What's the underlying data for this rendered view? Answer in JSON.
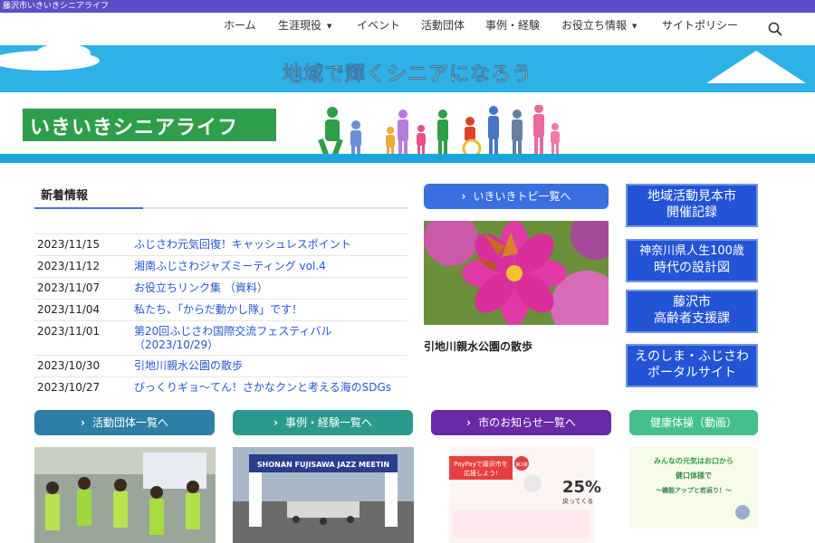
{
  "site": {
    "title": "藤沢市いきいきシニアライフ"
  },
  "nav": {
    "items": [
      "ホーム",
      "生涯現役",
      "イベント",
      "活動団体",
      "事例・経験",
      "お役立ち情報",
      "サイトポリシー"
    ]
  },
  "banner": {
    "slogan": "地域で輝くシニアになろう",
    "logo_text": "いきいきシニアライフ"
  },
  "news": {
    "heading": "新着情報",
    "items": [
      {
        "date": "2023/11/15",
        "title": "ふじさわ元気回復！キャッシュレスポイント"
      },
      {
        "date": "2023/11/12",
        "title": "湘南ふじさわジャズミーティング vol.4"
      },
      {
        "date": "2023/11/07",
        "title": "お役立ちリンク集 （資料）"
      },
      {
        "date": "2023/11/04",
        "title": "私たち、「からだ動かし隊」です！"
      },
      {
        "date": "2023/11/01",
        "title": "第20回ふじさわ国際交流フェスティバル（2023/10/29）"
      },
      {
        "date": "2023/10/30",
        "title": "引地川親水公園の散歩"
      },
      {
        "date": "2023/10/27",
        "title": "びっくりギョ〜てん！さかなクンと考える海のSDGs"
      }
    ]
  },
  "topics": {
    "button": "いきいきトピ一覧へ",
    "caption": "引地川親水公園の散歩"
  },
  "side_links": [
    {
      "line1": "地域活動見本市",
      "line2": "開催記録"
    },
    {
      "line1": "神奈川県人生100歳",
      "line2": "時代の設計図"
    },
    {
      "line1": "藤沢市",
      "line2": "高齢者支援課"
    },
    {
      "line1": "えのしま・ふじさわ",
      "line2": "ポータルサイト"
    }
  ],
  "cards": {
    "groups": "活動団体一覧へ",
    "cases": "事例・経験一覧へ",
    "notices": "市のお知らせ一覧へ",
    "exercise": "健康体操（動画）"
  },
  "card_images": {
    "jazz_sign": "SHONAN FUJISAWA JAZZ MEETIN",
    "paypay_a": "PayPayで藤沢市を",
    "paypay_b": "応援しよう!",
    "paypay_pct": "25%",
    "paypay_back": "戻ってくる",
    "paypay_round": "第2弾",
    "exercise_l1": "みんなの元気はお口から",
    "exercise_l2": "健口体操で",
    "exercise_l3": "〜機能アップと若返り！〜"
  },
  "colors": {
    "topbar": "#5a4fc7",
    "link": "#2356d6",
    "btn_blue": "#3b6ee0",
    "btn_teal": "#2e7fa6",
    "btn_green": "#2a9a8c",
    "btn_purple": "#6a2aa8",
    "btn_light_green": "#46c08a"
  }
}
